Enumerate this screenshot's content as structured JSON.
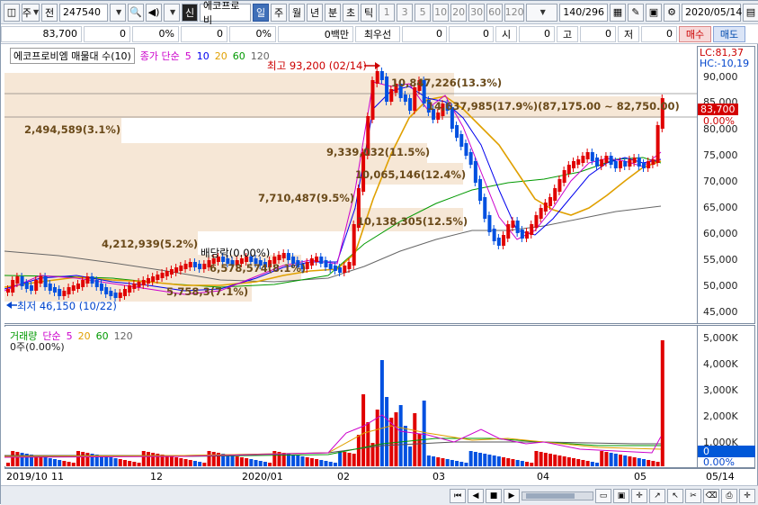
{
  "toolbar": {
    "market_label": "주",
    "prev_label": "전",
    "code_value": "247540",
    "shin_label": "신",
    "stock_name": "에코프로비",
    "periods": [
      "일",
      "주",
      "월",
      "년",
      "분",
      "초",
      "틱"
    ],
    "active_period": "일",
    "intervals": [
      "1",
      "3",
      "5",
      "10",
      "20",
      "30",
      "60",
      "120"
    ],
    "count_value": "140",
    "count_total": "/296",
    "date_value": "2020/05/14"
  },
  "quote": {
    "price": "83,700",
    "v1": "0",
    "p1": "0%",
    "v2": "0",
    "p2": "0%",
    "mil_label": "0백만",
    "best_label": "최우선",
    "best_v1": "0",
    "best_v2": "0",
    "open_label": "시",
    "open_v": "0",
    "high_label": "고",
    "high_v": "0",
    "low_label": "저",
    "low_v": "0",
    "buy_label": "매수",
    "sell_label": "매도"
  },
  "price_pane": {
    "title": "에코프로비엠 매물대 수(10)",
    "ma_label": "종가 단순",
    "ma_periods": [
      "5",
      "10",
      "20",
      "60",
      "120"
    ],
    "ma_colors": [
      "#cc00cc",
      "#0000ee",
      "#e0a000",
      "#009900",
      "#555555"
    ],
    "lc": "LC:81,37",
    "hc": "HC:-10,19",
    "current_price": "83,700",
    "current_pct": "0.00%",
    "high_note": "최고 93,200 (02/14)",
    "low_note": "최저 46,150 (10/22)",
    "dividend_note": "배당락(0.00%)",
    "y_ticks": [
      "90,000",
      "85,000",
      "80,000",
      "75,000",
      "70,000",
      "65,000",
      "60,000",
      "55,000",
      "50,000",
      "45,000"
    ],
    "volume_profile": [
      "10,847,226(13.3%)",
      "14,637,985(17.9%)(87,175.00 ~ 82,750.00)",
      "2,494,589(3.1%)",
      "9,339,032(11.5%)",
      "10,065,146(12.4%)",
      "7,710,487(9.5%)",
      "10,138,305(12.5%)",
      "4,212,939(5.2%)",
      "6,578,574(8.1%)",
      "5,758,3(7.1%)"
    ]
  },
  "volume_pane": {
    "title": "거래량",
    "ma_label": "단순",
    "ma_periods": [
      "5",
      "20",
      "60",
      "120"
    ],
    "ma_colors": [
      "#cc00cc",
      "#e0a000",
      "#009900",
      "#555555"
    ],
    "info": "0주(0.00%)",
    "y_ticks": [
      "5,000K",
      "4,000K",
      "3,000K",
      "2,000K",
      "1,000K"
    ],
    "current": "0",
    "current_pct": "0.00%"
  },
  "x_axis": [
    "2019/10",
    "11",
    "12",
    "2020/01",
    "02",
    "03",
    "04",
    "05",
    "05/14"
  ]
}
